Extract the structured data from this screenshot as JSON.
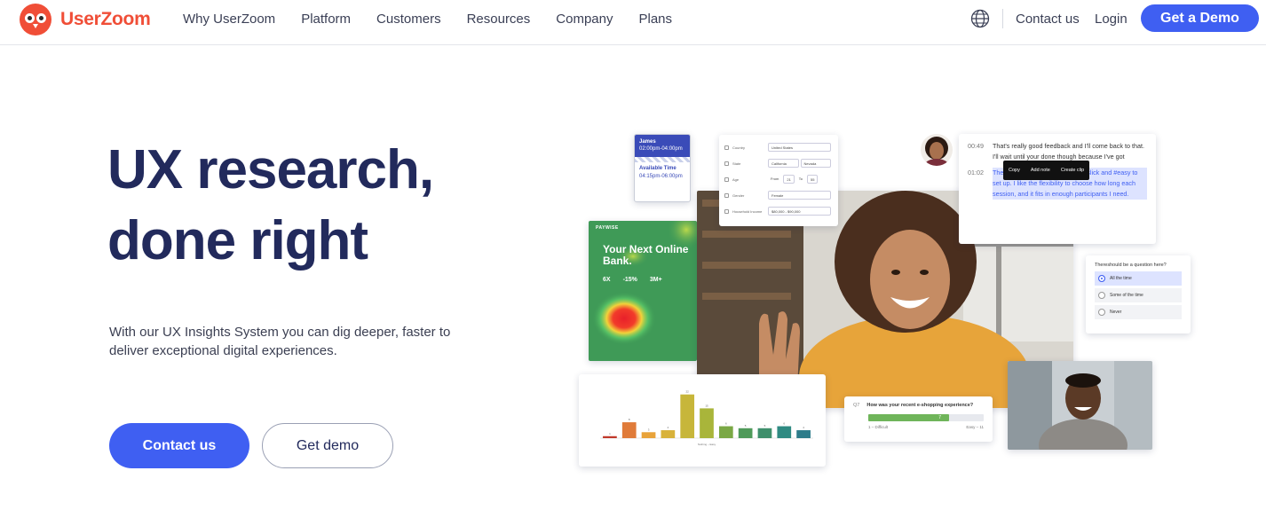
{
  "brand": {
    "name": "UserZoom",
    "color": "#f04e37"
  },
  "nav": {
    "items": [
      "Why UserZoom",
      "Platform",
      "Customers",
      "Resources",
      "Company",
      "Plans"
    ],
    "contact": "Contact us",
    "login": "Login",
    "cta": "Get a Demo",
    "globe_icon": "globe-icon"
  },
  "hero": {
    "title_line1": "UX research,",
    "title_line2": "done right",
    "subtitle": "With our UX Insights System you can dig deeper, faster to deliver exceptional digital experiences.",
    "primary_button": "Contact us",
    "secondary_button": "Get demo"
  },
  "colors": {
    "accent": "#3f5ff2",
    "heading": "#222a5c"
  },
  "schedule": {
    "name": "James",
    "time": "02:00pm-04:00pm",
    "label": "Available Time",
    "available": "04:15pm-06:00pm"
  },
  "form": {
    "rows": [
      {
        "label": "Country",
        "values": [
          "United States"
        ]
      },
      {
        "label": "State",
        "values": [
          "California",
          "Nevada"
        ]
      },
      {
        "label": "Age",
        "values": [
          "From",
          "21",
          "To",
          "55"
        ]
      },
      {
        "label": "Gender",
        "values": [
          "Female"
        ]
      },
      {
        "label": "Household Income",
        "values": [
          "$80,000 - $90,000"
        ]
      }
    ]
  },
  "bank": {
    "brand": "PAYWISE",
    "headline": "Your Next Online Bank.",
    "stats": [
      "6X",
      "-15%",
      "3M+"
    ]
  },
  "transcript": {
    "lines": [
      {
        "time": "00:49",
        "text": "That's really good feedback and I'll come back to that. I'll wait until your done though because I've got"
      },
      {
        "time": "01:02",
        "text": "The #scheduling feature is super slick and #easy to set up. I like the flexibility to choose how long each session, and it fits in enough participants I need."
      }
    ],
    "toolbar": [
      "Copy",
      "Add note",
      "Create clip"
    ]
  },
  "question": {
    "title": "Thereshould be a question here?",
    "options": [
      "All the time",
      "Some of the time",
      "Never"
    ],
    "selected": 0
  },
  "rating": {
    "number": "Q7",
    "question": "How was your recent e-shopping experience?",
    "value": "7",
    "fraction": 0.7,
    "low_label": "1 – Difficult",
    "high_label": "Easy – 11"
  },
  "chart_data": {
    "type": "bar",
    "categories": [
      "1",
      "2",
      "3",
      "4",
      "5",
      "6",
      "7",
      "8",
      "9",
      "10",
      "11"
    ],
    "values": [
      1,
      8,
      3,
      4,
      22,
      15,
      6,
      5,
      5,
      6,
      4
    ],
    "colors": [
      "#c0392b",
      "#e07b39",
      "#e8a33a",
      "#d8b23a",
      "#c7b63a",
      "#a9b53a",
      "#7aa845",
      "#4f9a5a",
      "#3f8f6c",
      "#2f8a82",
      "#2d7c8a"
    ],
    "ylim": [
      0,
      25
    ],
    "xlabel": "Nothing – Easy"
  }
}
